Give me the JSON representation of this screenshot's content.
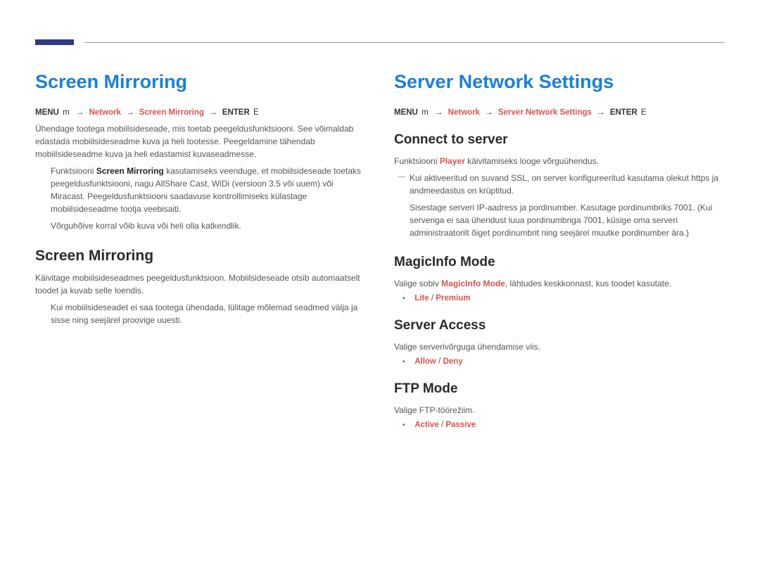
{
  "left": {
    "title": "Screen Mirroring",
    "breadcrumb": {
      "menu": "MENU",
      "menu_glyph": "m",
      "sep1": "→",
      "nav1": "Network",
      "sep2": "→",
      "nav2": "Screen Mirroring",
      "sep3": "→",
      "enter": "ENTER",
      "enter_glyph": "E"
    },
    "intro": "Ühendage tootega mobiilsideseade, mis toetab peegeldusfunktsiooni. See võimaldab edastada mobiilsideseadme kuva ja heli tootesse. Peegeldamine tähendab mobiilsideseadme kuva ja heli edastamist kuvaseadmesse.",
    "note1_pre": "Funktsiooni ",
    "note1_bold": "Screen Mirroring",
    "note1_post": " kasutamiseks veenduge, et mobiilsideseade toetaks peegeldusfunktsiooni, nagu AllShare Cast, WiDi (versioon 3.5 või uuem) või Miracast. Peegeldusfunktsiooni saadavuse kontrollimiseks külastage mobiilsideseadme tootja veebisaiti.",
    "note2": "Võrguhõive korral võib kuva või heli olla katkendlik.",
    "sub_title": "Screen Mirroring",
    "sub_body": "Käivitage mobiilsideseadmes peegeldusfunktsioon. Mobiilsideseade otsib automaatselt toodet ja kuvab selle loendis.",
    "sub_note": "Kui mobiilsideseadet ei saa tootega ühendada, lülitage mõlemad seadmed välja ja sisse ning seejärel proovige uuesti."
  },
  "right": {
    "title": "Server Network Settings",
    "breadcrumb": {
      "menu": "MENU",
      "menu_glyph": "m",
      "sep1": "→",
      "nav1": "Network",
      "sep2": "→",
      "nav2": "Server Network Settings",
      "sep3": "→",
      "enter": "ENTER",
      "enter_glyph": "E"
    },
    "connect": {
      "heading": "Connect to server",
      "body_pre": "Funktsiooni ",
      "body_bold": "Player",
      "body_post": " käivitamiseks looge võrguühendus.",
      "note1_pre": "Kui aktiveeritud on suvand ",
      "note1_bold1": "SSL",
      "note1_mid": ", on server konfigureeritud kasutama olekut ",
      "note1_bold2": "https",
      "note1_post": " ja andmeedastus on krüptitud.",
      "note2": "Sisestage serveri IP-aadress ja pordinumber. Kasutage pordinumbriks 7001. (Kui serveriga ei saa ühendust luua pordinumbriga 7001, küsige oma serveri administraatorilt õiget pordinumbrit ning seejärel muutke pordinumber ära.)"
    },
    "magicinfo": {
      "heading": "MagicInfo Mode",
      "body_pre": "Valige sobiv ",
      "body_bold": "MagicInfo Mode",
      "body_post": ", lähtudes keskkonnast, kus toodet kasutate.",
      "opt1": "Lite",
      "opt_sep": " / ",
      "opt2": "Premium"
    },
    "server_access": {
      "heading": "Server Access",
      "body": "Valige serverivõrguga ühendamise viis.",
      "opt1": "Allow",
      "opt_sep": " / ",
      "opt2": "Deny"
    },
    "ftp": {
      "heading": "FTP Mode",
      "body": "Valige FTP-töörežiim.",
      "opt1": "Active",
      "opt_sep": " / ",
      "opt2": "Passive"
    }
  }
}
